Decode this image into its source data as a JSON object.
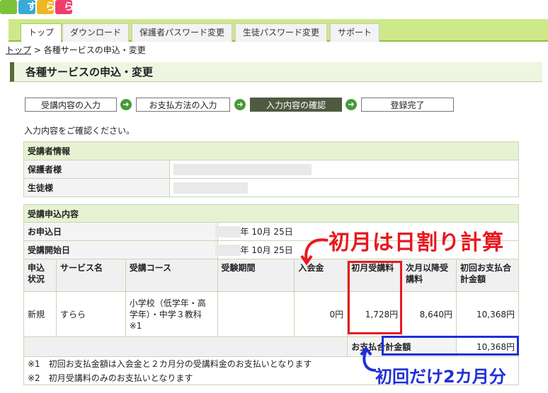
{
  "logo": {
    "text": "すらら"
  },
  "nav": {
    "tabs": [
      "トップ",
      "ダウンロード",
      "保護者パスワード変更",
      "生徒パスワード変更",
      "サポート"
    ]
  },
  "breadcrumb": {
    "home": "トップ",
    "sep": ">",
    "current": "各種サービスの申込・変更"
  },
  "page_title": "各種サービスの申込・変更",
  "steps": [
    "受講内容の入力",
    "お支払方法の入力",
    "入力内容の確認",
    "登録完了"
  ],
  "instruction": "入力内容をご確認ください。",
  "student_info": {
    "header": "受講者情報",
    "guardian_label": "保護者様",
    "student_label": "生徒様"
  },
  "application": {
    "header": "受講申込内容",
    "apply_date_label": "お申込日",
    "apply_date": "年 10月 25日",
    "start_date_label": "受講開始日",
    "start_date": "年 10月 25日",
    "columns": [
      "申込状況",
      "サービス名",
      "受講コース",
      "受験期間",
      "入会金",
      "初月受講料",
      "次月以降受講料",
      "初回お支払合計金額"
    ],
    "row": {
      "status": "新規",
      "service": "すらら",
      "course": "小学校（低学年・高学年）・中学３教科",
      "course_note": "※1",
      "period": "",
      "entry_fee": "0円",
      "first_month": "1,728円",
      "next_months": "8,640円",
      "first_total": "10,368円"
    },
    "total_label": "お支払合計金額",
    "total_value": "10,368円",
    "footnotes": [
      "※1　初回お支払金額は入会金と２カ月分の受講料金のお支払いとなります",
      "※2　初月受講料のみのお支払いとなります"
    ]
  },
  "annotations": {
    "red": "初月は日割り計算",
    "blue": "初回だけ2カ月分"
  },
  "colors": {
    "accent_red": "#e8191f",
    "accent_blue": "#1f2fd8",
    "nav_green": "#cde98a"
  }
}
